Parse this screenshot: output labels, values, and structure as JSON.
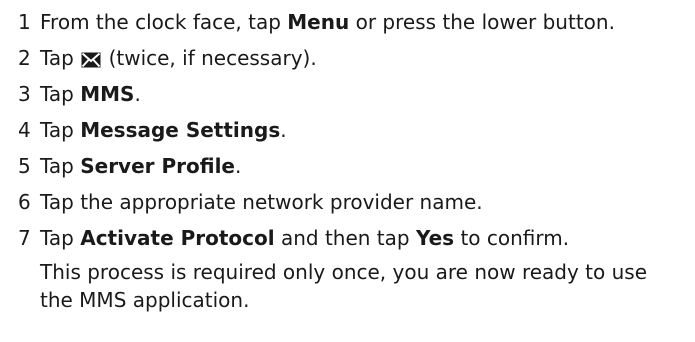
{
  "steps": [
    {
      "num": "1",
      "pre": "From the clock face, tap ",
      "bold": "Menu",
      "post": " or press the lower button."
    },
    {
      "num": "2",
      "pre": "Tap ",
      "icon": "envelope-icon",
      "post": " (twice, if necessary)."
    },
    {
      "num": "3",
      "pre": "Tap ",
      "bold": "MMS",
      "post": "."
    },
    {
      "num": "4",
      "pre": "Tap ",
      "bold": "Message Settings",
      "post": "."
    },
    {
      "num": "5",
      "pre": "Tap ",
      "bold": "Server Profile",
      "post": "."
    },
    {
      "num": "6",
      "pre": "Tap the appropriate network provider name."
    },
    {
      "num": "7",
      "pre": "Tap ",
      "bold": "Activate Protocol",
      "mid": " and then tap ",
      "bold2": "Yes",
      "post": " to confirm."
    }
  ],
  "note": "This process is required only once, you are now ready to use the MMS application.",
  "colors": {
    "text": "#1a1a1a",
    "background": "#ffffff"
  }
}
